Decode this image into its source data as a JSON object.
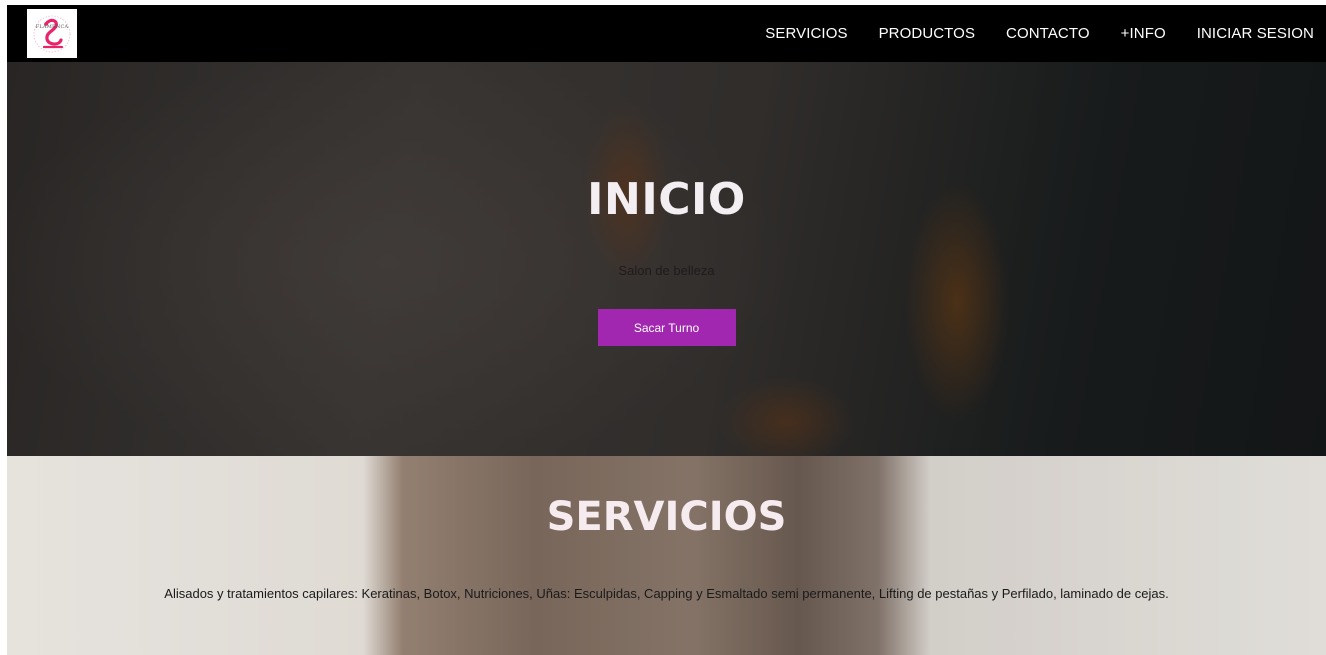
{
  "nav": {
    "logo_text": "FLAMENCA",
    "links": [
      "SERVICIOS",
      "PRODUCTOS",
      "CONTACTO",
      "+INFO",
      "INICIAR SESION"
    ]
  },
  "hero": {
    "title": "INICIO",
    "subtitle": "Salon de belleza",
    "cta_label": "Sacar Turno"
  },
  "services": {
    "title": "SERVICIOS",
    "description": "Alisados y tratamientos capilares: Keratinas, Botox, Nutriciones, Uñas: Esculpidas, Capping y Esmaltado semi permanente, Lifting de pestañas y Perfilado, laminado de cejas."
  },
  "colors": {
    "nav_bg": "#000000",
    "accent": "#a227b0",
    "logo_pink": "#e8236a"
  }
}
